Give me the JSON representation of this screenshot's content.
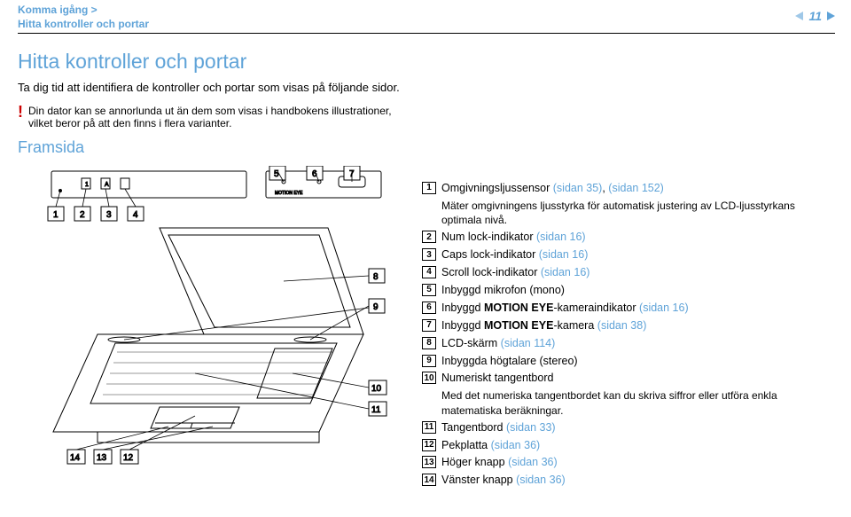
{
  "header": {
    "breadcrumb_line1": "Komma igång >",
    "breadcrumb_line2": "Hitta kontroller och portar",
    "page_number": "11"
  },
  "title": "Hitta kontroller och portar",
  "intro": "Ta dig tid att identifiera de kontroller och portar som visas på följande sidor.",
  "note": "Din dator kan se annorlunda ut än dem som visas i handbokens illustrationer, vilket beror på att den finns i flera varianter.",
  "section": "Framsida",
  "items": [
    {
      "n": "1",
      "text": "Omgivningsljussensor ",
      "link": "(sidan 35)",
      "extra": ", ",
      "link2": "(sidan 152)"
    },
    {
      "sub": "Mäter omgivningens ljusstyrka för automatisk justering av LCD-ljusstyrkans optimala nivå."
    },
    {
      "n": "2",
      "text": "Num lock-indikator ",
      "link": "(sidan 16)"
    },
    {
      "n": "3",
      "text": "Caps lock-indikator ",
      "link": "(sidan 16)"
    },
    {
      "n": "4",
      "text": "Scroll lock-indikator ",
      "link": "(sidan 16)"
    },
    {
      "n": "5",
      "text": "Inbyggd mikrofon (mono)"
    },
    {
      "n": "6",
      "text": "Inbyggd ",
      "bold": "MOTION EYE",
      "text2": "-kameraindikator ",
      "link": "(sidan 16)"
    },
    {
      "n": "7",
      "text": "Inbyggd ",
      "bold": "MOTION EYE",
      "text2": "-kamera ",
      "link": "(sidan 38)"
    },
    {
      "n": "8",
      "text": "LCD-skärm ",
      "link": "(sidan 114)"
    },
    {
      "n": "9",
      "text": "Inbyggda högtalare (stereo)"
    },
    {
      "n": "10",
      "text": "Numeriskt tangentbord"
    },
    {
      "sub": "Med det numeriska tangentbordet kan du skriva siffror eller utföra enkla matematiska beräkningar."
    },
    {
      "n": "11",
      "text": "Tangentbord ",
      "link": "(sidan 33)"
    },
    {
      "n": "12",
      "text": "Pekplatta ",
      "link": "(sidan 36)"
    },
    {
      "n": "13",
      "text": "Höger knapp ",
      "link": "(sidan 36)"
    },
    {
      "n": "14",
      "text": "Vänster knapp ",
      "link": "(sidan 36)"
    }
  ]
}
